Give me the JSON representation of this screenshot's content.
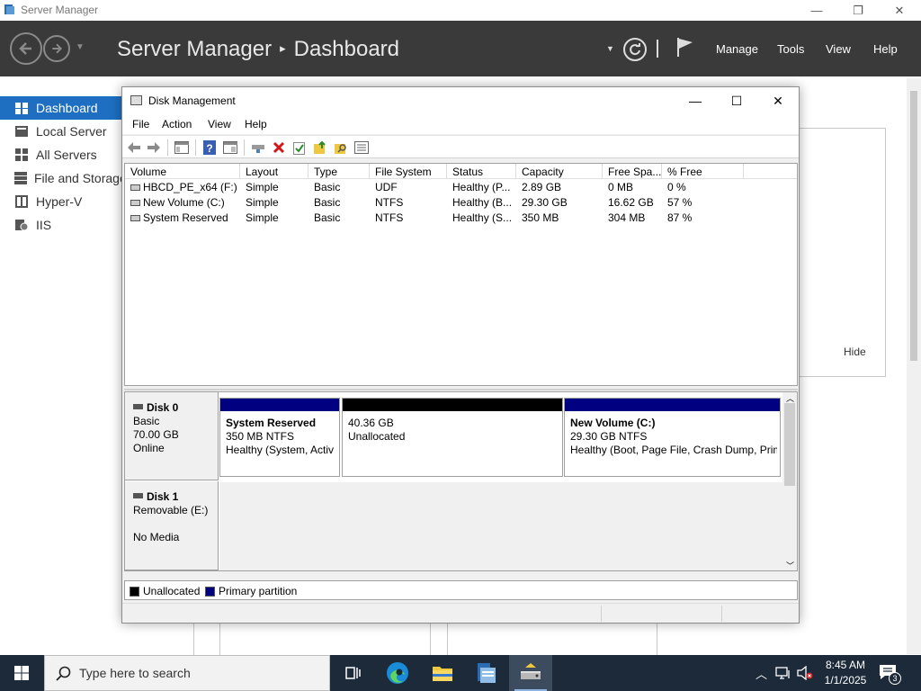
{
  "server_manager": {
    "window_title": "Server Manager",
    "breadcrumb_root": "Server Manager",
    "breadcrumb_sep": "▸",
    "breadcrumb_page": "Dashboard",
    "menu": {
      "manage": "Manage",
      "tools": "Tools",
      "view": "View",
      "help": "Help"
    },
    "sidebar": [
      {
        "label": "Dashboard",
        "icon": "dashboard-icon",
        "active": true
      },
      {
        "label": "Local Server",
        "icon": "server-icon"
      },
      {
        "label": "All Servers",
        "icon": "servers-icon"
      },
      {
        "label": "File and Storage Services",
        "icon": "storage-icon"
      },
      {
        "label": "Hyper-V",
        "icon": "hyperv-icon"
      },
      {
        "label": "IIS",
        "icon": "iis-icon"
      }
    ],
    "hide_link": "Hide"
  },
  "disk_mgmt": {
    "title": "Disk Management",
    "menu": [
      "File",
      "Action",
      "View",
      "Help"
    ],
    "columns": [
      "Volume",
      "Layout",
      "Type",
      "File System",
      "Status",
      "Capacity",
      "Free Spa...",
      "% Free"
    ],
    "rows": [
      [
        "HBCD_PE_x64 (F:)",
        "Simple",
        "Basic",
        "UDF",
        "Healthy (P...",
        "2.89 GB",
        "0 MB",
        "0 %"
      ],
      [
        "New Volume (C:)",
        "Simple",
        "Basic",
        "NTFS",
        "Healthy (B...",
        "29.30 GB",
        "16.62 GB",
        "57 %"
      ],
      [
        "System Reserved",
        "Simple",
        "Basic",
        "NTFS",
        "Healthy (S...",
        "350 MB",
        "304 MB",
        "87 %"
      ]
    ],
    "disks": [
      {
        "name": "Disk 0",
        "type": "Basic",
        "size": "70.00 GB",
        "state": "Online",
        "partitions": [
          {
            "name": "System Reserved",
            "size": "350 MB NTFS",
            "status": "Healthy (System, Activ",
            "kind": "primary"
          },
          {
            "name": "",
            "size": "40.36 GB",
            "status": "Unallocated",
            "kind": "unallocated"
          },
          {
            "name": "New Volume  (C:)",
            "size": "29.30 GB NTFS",
            "status": "Healthy (Boot, Page File, Crash Dump, Prim",
            "kind": "primary"
          }
        ]
      },
      {
        "name": "Disk 1",
        "type": "Removable (E:)",
        "size": "",
        "state": "No Media"
      }
    ],
    "legend": {
      "unallocated": "Unallocated",
      "primary": "Primary partition"
    },
    "colors": {
      "unallocated": "#000000",
      "primary": "#000080"
    }
  },
  "taskbar": {
    "search_placeholder": "Type here to search",
    "time": "8:45 AM",
    "date": "1/1/2025",
    "notification_count": "3"
  }
}
